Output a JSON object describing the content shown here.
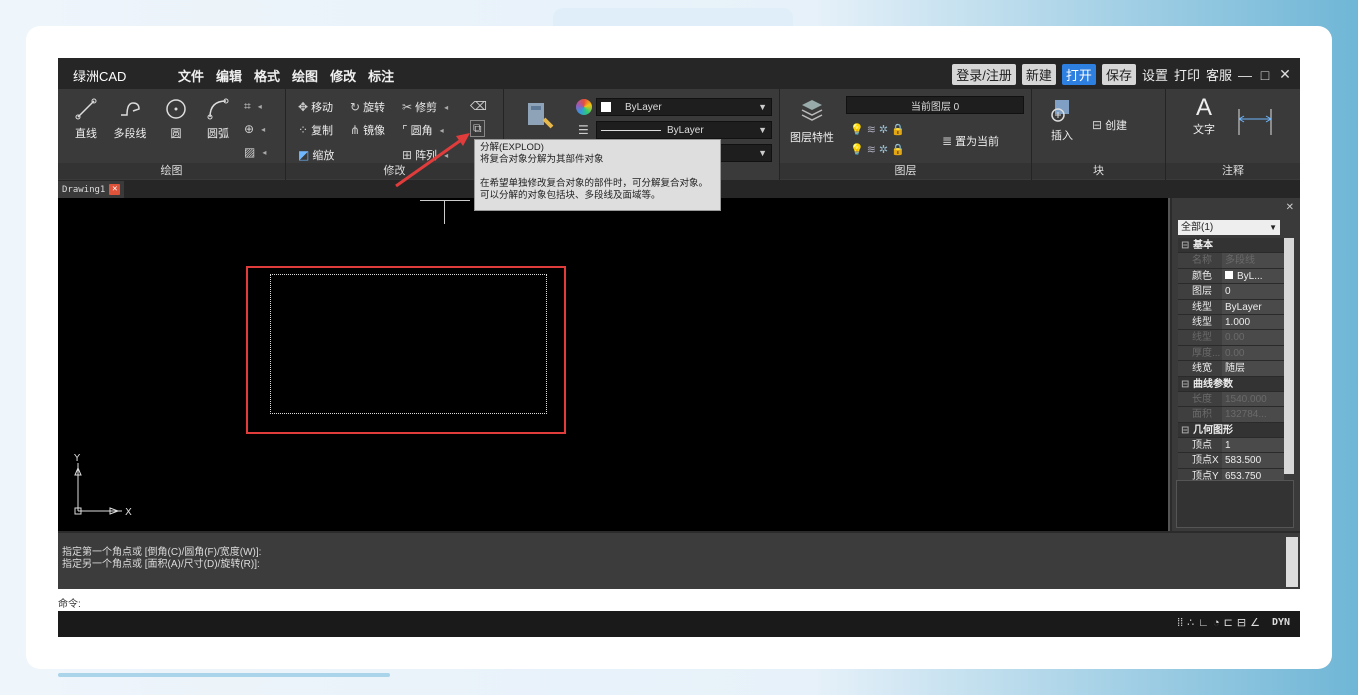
{
  "app": {
    "name": "绿洲CAD",
    "menu": [
      "文件",
      "编辑",
      "格式",
      "绘图",
      "修改",
      "标注"
    ],
    "right_buttons": {
      "login": "登录/注册",
      "new": "新建",
      "open": "打开",
      "save": "保存",
      "settings": "设置",
      "print": "打印",
      "support": "客服"
    },
    "window_controls": [
      "—",
      "□",
      "✕"
    ]
  },
  "ribbon": {
    "draw": {
      "label": "绘图",
      "tools": [
        "直线",
        "多段线",
        "圆",
        "圆弧"
      ]
    },
    "modify": {
      "label": "修改",
      "tools": [
        "移动",
        "旋转",
        "修剪",
        "复制",
        "镜像",
        "圆角",
        "缩放",
        "阵列"
      ]
    },
    "properties": {
      "color_value": "ByLayer",
      "linetype_value": "ByLayer"
    },
    "layers": {
      "label": "图层",
      "layer_props": "图层特性",
      "current_layer": "当前图层  0",
      "set_current": "置为当前"
    },
    "block": {
      "label": "块",
      "insert": "插入",
      "create": "创建"
    },
    "annotation": {
      "label": "注释",
      "text": "文字"
    }
  },
  "tooltip": {
    "title": "分解(EXPLOD)",
    "line1": "将复合对象分解为其部件对象",
    "line2": "在希望单独修改复合对象的部件时，可分解复合对象。",
    "line3": "可以分解的对象包括块、多段线及面域等。"
  },
  "document": {
    "tab_name": "Drawing1"
  },
  "ucs": {
    "y": "Y",
    "x": "X"
  },
  "properties_panel": {
    "selector": "全部(1)",
    "rows": [
      {
        "type": "cat",
        "k": "基本"
      },
      {
        "type": "dim",
        "k": "名称",
        "v": "多段线"
      },
      {
        "type": "row",
        "k": "颜色",
        "v": "ByL...",
        "swatch": true
      },
      {
        "type": "row",
        "k": "图层",
        "v": "0"
      },
      {
        "type": "row",
        "k": "线型",
        "v": "ByLayer"
      },
      {
        "type": "row",
        "k": "线型比...",
        "v": "1.000"
      },
      {
        "type": "dim",
        "k": "线型生...",
        "v": "0.00"
      },
      {
        "type": "dim",
        "k": "厚度...",
        "v": "0.00"
      },
      {
        "type": "row",
        "k": "线宽",
        "v": "随层"
      },
      {
        "type": "cat",
        "k": "曲线参数"
      },
      {
        "type": "dim",
        "k": "长度",
        "v": "1540.000"
      },
      {
        "type": "dim",
        "k": "面积",
        "v": "132784..."
      },
      {
        "type": "cat",
        "k": "几何图形"
      },
      {
        "type": "row",
        "k": "顶点",
        "v": "1"
      },
      {
        "type": "row",
        "k": "顶点X",
        "v": "583.500"
      },
      {
        "type": "row",
        "k": "顶点Y",
        "v": "653.750"
      }
    ]
  },
  "command": {
    "history1": "指定第一个角点或 [倒角(C)/圆角(F)/宽度(W)]:",
    "history2": "指定另一个角点或 [面积(A)/尺寸(D)/旋转(R)]:",
    "prompt": "命令:"
  },
  "status": {
    "dyn": "DYN"
  },
  "colors": {
    "accent": "#2d7fe0",
    "highlight_red": "#e03c3c",
    "canvas": "#000000"
  }
}
